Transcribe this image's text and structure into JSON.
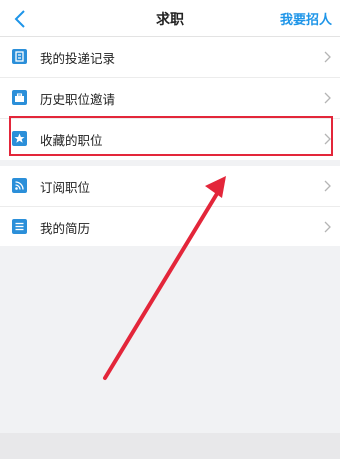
{
  "navbar": {
    "back_icon": "chevron-left-icon",
    "title": "求职",
    "action_label": "我要招人"
  },
  "accent_color": "#1e95e8",
  "icon_color": "#2b8fd9",
  "highlight_color": "#e3263a",
  "group1": {
    "items": [
      {
        "label": "我的投递记录",
        "icon": "clipboard-icon"
      },
      {
        "label": "历史职位邀请",
        "icon": "briefcase-icon"
      },
      {
        "label": "收藏的职位",
        "icon": "star-icon"
      }
    ]
  },
  "group2": {
    "items": [
      {
        "label": "订阅职位",
        "icon": "rss-icon"
      },
      {
        "label": "我的简历",
        "icon": "document-list-icon"
      }
    ]
  }
}
